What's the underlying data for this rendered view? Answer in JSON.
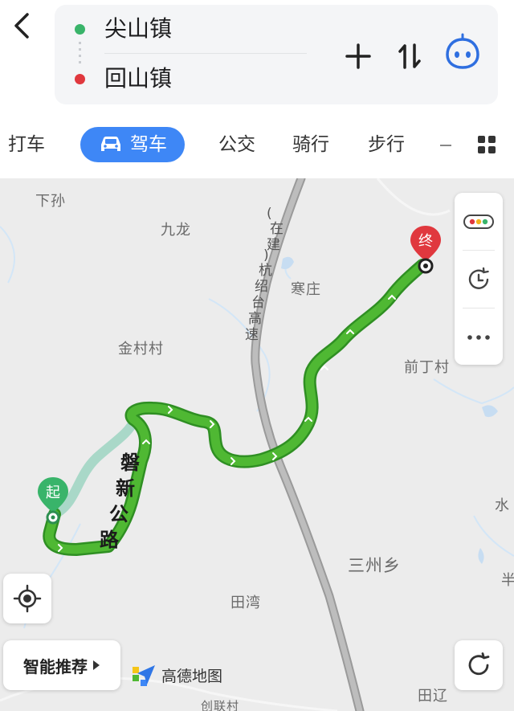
{
  "header": {
    "origin": "尖山镇",
    "destination": "回山镇"
  },
  "modes": {
    "taxi": "打车",
    "drive": "驾车",
    "bus": "公交",
    "bike": "骑行",
    "walk": "步行",
    "active": "drive"
  },
  "map": {
    "places": {
      "xiasun": "下孙",
      "jiulong": "九龙",
      "zaozhuang": "寒庄",
      "jincun": "金村村",
      "qianding": "前丁村",
      "shui": "水",
      "sanzhou": "三州乡",
      "ban": "半",
      "tianwan": "田湾",
      "tianliao": "田辽",
      "lianxing": "创联村"
    },
    "highway_chars": [
      "(",
      "在",
      "建",
      ")",
      "杭",
      "绍",
      "台",
      "高",
      "速"
    ],
    "road_chars": [
      "磐",
      "新",
      "公",
      "路"
    ],
    "start_marker": "起",
    "end_marker": "终",
    "route_color": "#4fb833",
    "alt_route_color": "#a9d8c8",
    "icons": [
      "traffic-icon",
      "clock-icon",
      "more-icon",
      "locate-icon",
      "refresh-icon"
    ]
  },
  "bottom": {
    "smart_label": "智能推荐",
    "logo_text": "高德地图"
  },
  "colors": {
    "accent": "#3e87f6",
    "start_dot": "#39b46a",
    "end_dot": "#e0383e"
  }
}
